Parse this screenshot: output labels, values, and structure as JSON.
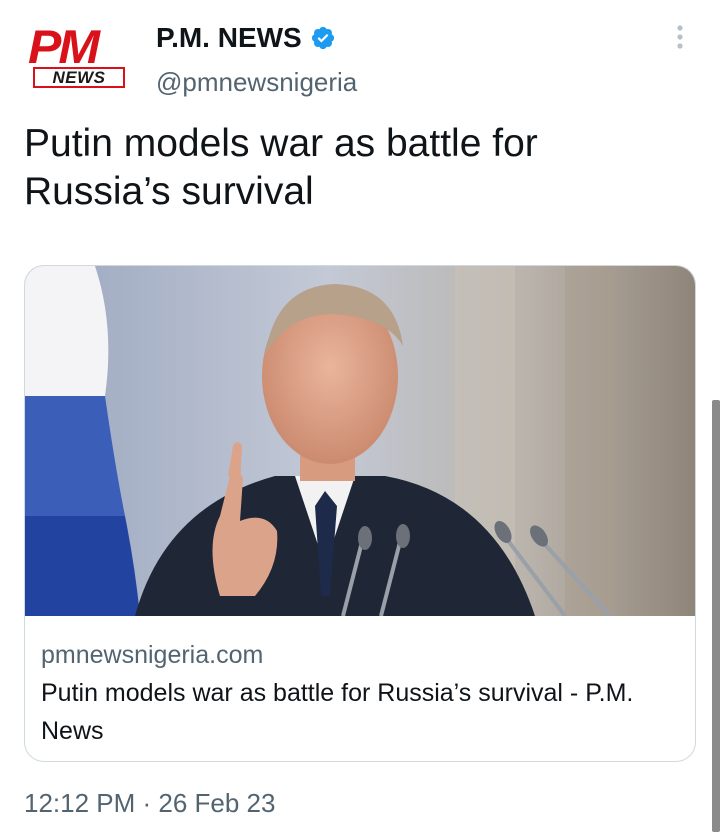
{
  "account": {
    "avatar_top": "PM",
    "avatar_bottom": "NEWS",
    "display_name": "P.M. NEWS",
    "handle": "@pmnewsnigeria",
    "verified": true,
    "verified_color": "#1d9bf0",
    "brand_color": "#d9111b"
  },
  "tweet": {
    "text": "Putin models war as battle for\nRussia’s survival",
    "timestamp": "12:12 PM · 26 Feb 23"
  },
  "card": {
    "image_alt": "Vladimir Putin speaking at podium with microphones, Russian flag behind",
    "domain": "pmnewsnigeria.com",
    "title": "Putin models war as battle for Russia’s survival - P.M. News"
  },
  "icons": {
    "more": "more-vertical-icon",
    "verified": "verified-badge-icon"
  }
}
